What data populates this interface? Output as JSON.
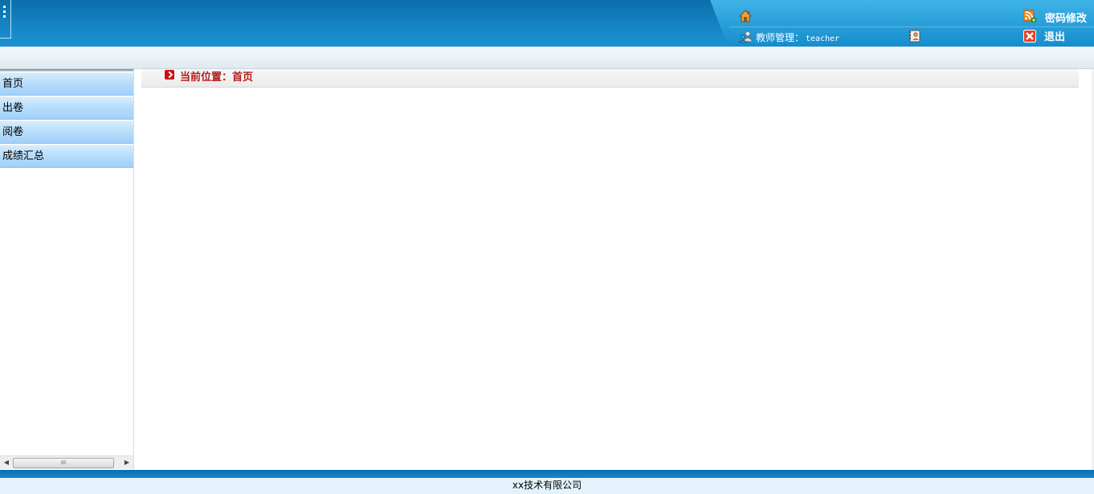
{
  "header": {
    "user_label": "教师管理：",
    "username": "teacher",
    "change_password": "密码修改",
    "logout": "退出"
  },
  "breadcrumb": {
    "text": "当前位置：首页"
  },
  "sidebar": {
    "items": [
      {
        "label": "首页"
      },
      {
        "label": "出卷"
      },
      {
        "label": "阅卷"
      },
      {
        "label": "成绩汇总"
      }
    ],
    "scroll_grip": "III"
  },
  "footer": {
    "text": "xx技术有限公司"
  },
  "colors": {
    "header_blue": "#1684c4",
    "menu_blue": "#b6dcfb",
    "breadcrumb_red": "#b21e1e"
  },
  "icons": [
    "home-icon",
    "user-icon",
    "contacts-icon",
    "rss-icon",
    "close-icon",
    "arrow-right-icon"
  ]
}
